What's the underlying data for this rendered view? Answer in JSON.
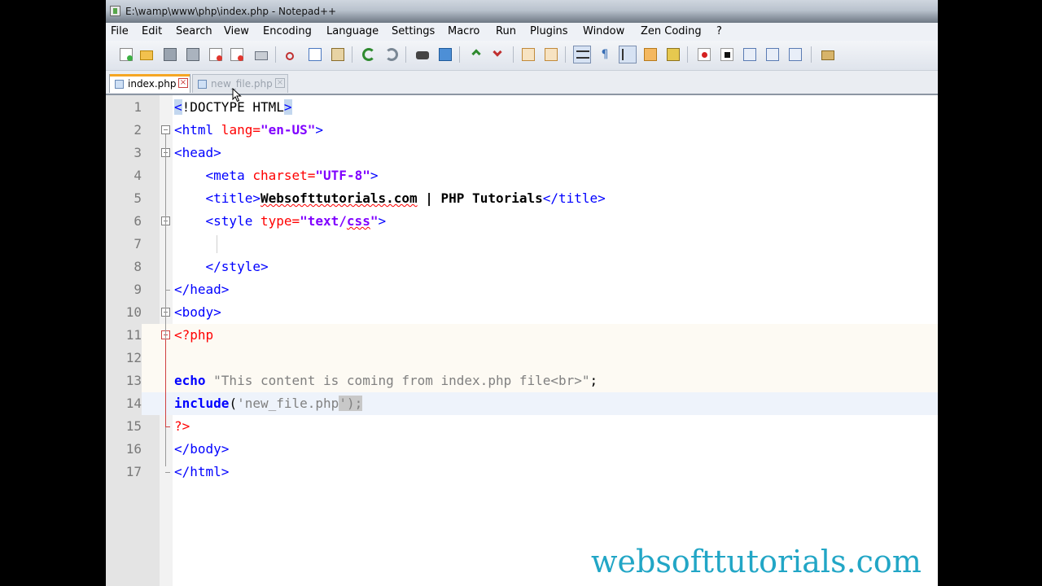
{
  "window": {
    "title": "E:\\wamp\\www\\php\\index.php - Notepad++"
  },
  "menu": {
    "items": [
      "File",
      "Edit",
      "Search",
      "View",
      "Encoding",
      "Language",
      "Settings",
      "Macro",
      "Run",
      "Plugins",
      "Window",
      "Zen Coding",
      "?"
    ]
  },
  "toolbar": {
    "icons": [
      "new-file-icon",
      "open-file-icon",
      "save-icon",
      "save-all-icon",
      "close-icon",
      "close-all-icon",
      "print-icon",
      "cut-icon",
      "copy-icon",
      "paste-icon",
      "undo-icon",
      "redo-icon",
      "find-icon",
      "replace-icon",
      "zoom-in-icon",
      "zoom-out-icon",
      "sync-v-icon",
      "sync-h-icon",
      "wrap-icon",
      "show-all-chars-icon",
      "indent-guide-icon",
      "user-lang-icon",
      "doc-map-icon",
      "function-list-icon",
      "record-macro-icon",
      "stop-record-icon",
      "play-macro-icon",
      "run-macro-multi-icon",
      "save-macro-icon",
      "plugin-icon"
    ]
  },
  "tabs": [
    {
      "label": "index.php",
      "active": true
    },
    {
      "label": "new_file.php",
      "active": false
    }
  ],
  "editor": {
    "line_numbers": [
      "1",
      "2",
      "3",
      "4",
      "5",
      "6",
      "7",
      "8",
      "9",
      "10",
      "11",
      "12",
      "13",
      "14",
      "15",
      "16",
      "17"
    ],
    "lines": {
      "l1": {
        "lt": "<",
        "bang": "!DOCTYPE HTML",
        "gt": ">"
      },
      "l2": {
        "open": "<html",
        "attr": " lang=",
        "val": "\"en-US\"",
        "close": ">"
      },
      "l3": {
        "tag": "<head>"
      },
      "l4": {
        "indent": "    ",
        "open": "<meta",
        "attr": " charset=",
        "val": "\"UTF-8\"",
        "close": ">"
      },
      "l5": {
        "indent": "    ",
        "open": "<title>",
        "text_a": "Websofttutorials.com",
        "text_b": " | PHP Tutorials",
        "close": "</title>"
      },
      "l6": {
        "indent": "    ",
        "open": "<style",
        "attr": " type=",
        "val_a": "\"text/",
        "val_b": "css",
        "val_c": "\"",
        "close": ">"
      },
      "l7": {
        "text": ""
      },
      "l8": {
        "indent": "    ",
        "tag": "</style>"
      },
      "l9": {
        "tag": "</head>"
      },
      "l10": {
        "tag": "<body>"
      },
      "l11": {
        "php": "<?php"
      },
      "l12": {
        "text": ""
      },
      "l13": {
        "kw": "echo",
        "str": " \"This content is coming from index.php file<br>\"",
        "op": ";"
      },
      "l14": {
        "kw": "include",
        "paren": "(",
        "str": "'new_file.php",
        "sel": "');"
      },
      "l15": {
        "php": "?>"
      },
      "l16": {
        "tag": "</body>"
      },
      "l17": {
        "tag": "</html>"
      }
    }
  },
  "watermark": {
    "text": "websofttutorials.com"
  },
  "colors": {
    "tag": "#0000ff",
    "attribute": "#ff0000",
    "value": "#8000ff",
    "php_delimiter": "#ff0000",
    "keyword": "#0000ff",
    "string": "#808080",
    "watermark": "#22a6c6"
  }
}
